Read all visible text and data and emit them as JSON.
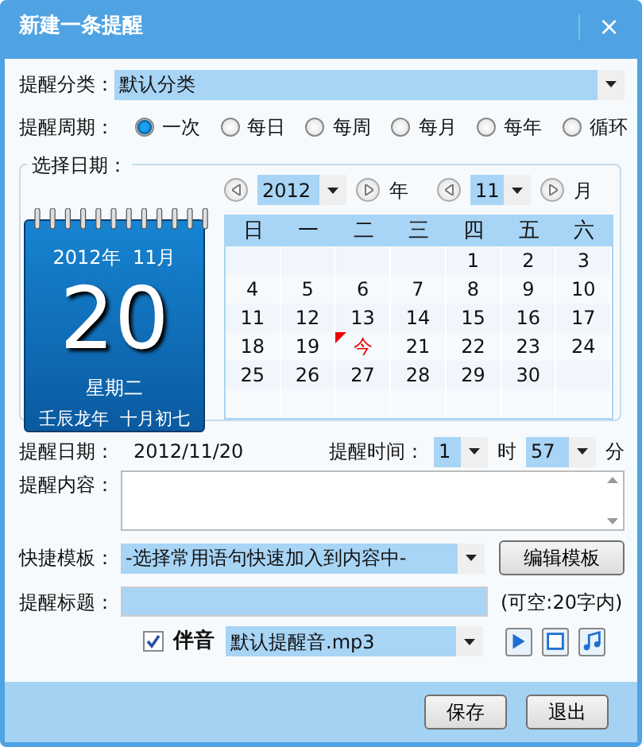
{
  "window": {
    "title": "新建一条提醒",
    "close": "×"
  },
  "category": {
    "label": "提醒分类：",
    "value": "默认分类"
  },
  "period": {
    "label": "提醒周期：",
    "options": [
      {
        "label": "一次",
        "selected": true
      },
      {
        "label": "每日",
        "selected": false
      },
      {
        "label": "每周",
        "selected": false
      },
      {
        "label": "每月",
        "selected": false
      },
      {
        "label": "每年",
        "selected": false
      },
      {
        "label": "循环",
        "selected": false
      }
    ]
  },
  "date_picker": {
    "label": "选择日期：",
    "year": {
      "value": "2012",
      "unit": "年"
    },
    "month": {
      "value": "11",
      "unit": "月"
    },
    "desk_calendar": {
      "year_month": "2012年  11月",
      "day": "20",
      "weekday": "星期二",
      "lunar": "壬辰龙年  十月初七"
    },
    "weekdays": [
      "日",
      "一",
      "二",
      "三",
      "四",
      "五",
      "六"
    ],
    "weeks": [
      [
        {
          "text": "1",
          "today": false
        },
        {
          "text": "2",
          "today": false
        },
        {
          "text": "3",
          "today": false
        }
      ],
      [
        {
          "text": "4",
          "today": false
        },
        {
          "text": "5",
          "today": false
        },
        {
          "text": "6",
          "today": false
        },
        {
          "text": "7",
          "today": false
        },
        {
          "text": "8",
          "today": false
        },
        {
          "text": "9",
          "today": false
        },
        {
          "text": "10",
          "today": false
        }
      ],
      [
        {
          "text": "11",
          "today": false
        },
        {
          "text": "12",
          "today": false
        },
        {
          "text": "13",
          "today": false
        },
        {
          "text": "14",
          "today": false
        },
        {
          "text": "15",
          "today": false
        },
        {
          "text": "16",
          "today": false
        },
        {
          "text": "17",
          "today": false
        }
      ],
      [
        {
          "text": "18",
          "today": false
        },
        {
          "text": "19",
          "today": false
        },
        {
          "text": "今",
          "today": true
        },
        {
          "text": "21",
          "today": false
        },
        {
          "text": "22",
          "today": false
        },
        {
          "text": "23",
          "today": false
        },
        {
          "text": "24",
          "today": false
        }
      ],
      [
        {
          "text": "25",
          "today": false
        },
        {
          "text": "26",
          "today": false
        },
        {
          "text": "27",
          "today": false
        },
        {
          "text": "28",
          "today": false
        },
        {
          "text": "29",
          "today": false
        },
        {
          "text": "30",
          "today": false
        }
      ]
    ]
  },
  "reminder_date": {
    "label": "提醒日期：",
    "value": "2012/11/20"
  },
  "reminder_time": {
    "label": "提醒时间：",
    "hour": "1",
    "hour_unit": "时",
    "minute": "57",
    "minute_unit": "分"
  },
  "content": {
    "label": "提醒内容："
  },
  "template": {
    "label": "快捷模板：",
    "value": "-选择常用语句快速加入到内容中-",
    "button": "编辑模板"
  },
  "title_field": {
    "label": "提醒标题：",
    "hint": "(可空:20字内)"
  },
  "sound": {
    "label": "伴音",
    "checked": true,
    "value": "默认提醒音.mp3"
  },
  "buttons": [
    "保存",
    "退出"
  ]
}
